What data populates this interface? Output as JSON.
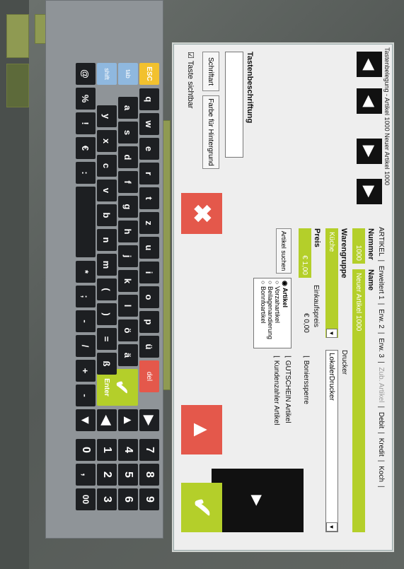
{
  "window": {
    "title": "Tastenbelegung - Artikel 1000 Neuer Artikel 1000"
  },
  "nav": {
    "first_icon": "skip-start-icon",
    "prev_icon": "arrow-left-icon",
    "next_icon": "arrow-right-icon",
    "last_icon": "skip-end-icon"
  },
  "tabs": [
    {
      "label": "ARTIKEL",
      "disabled": false
    },
    {
      "label": "Erweitert 1",
      "disabled": false
    },
    {
      "label": "Erw. 2",
      "disabled": false
    },
    {
      "label": "Erw. 3",
      "disabled": false
    },
    {
      "label": "Zub. Artikel",
      "disabled": true
    },
    {
      "label": "Debit",
      "disabled": false
    },
    {
      "label": "Kredit",
      "disabled": false
    },
    {
      "label": "Koch",
      "disabled": false
    }
  ],
  "form": {
    "nummer_label": "Nummer",
    "nummer_value": "1000",
    "name_label": "Name",
    "name_value": "Neuer Artikel 1000",
    "warengruppe_label": "Warengruppe",
    "warengruppe_value": "Küche",
    "drucker_label": "Drucker",
    "drucker_value": "LokalerDrucker",
    "preis_label": "Preis",
    "preis_value": "€ 1,00",
    "einkaufspreis_label": "Einkaufspreis",
    "einkaufspreis_value": "€ 0,00",
    "bonierssperre_label": "Bonierssperre",
    "gutschein_label": "GUTSCHEIN Artikel",
    "kundenzahler_label": "Kundenzahler Artikel",
    "artikel_suchen": "Artikel suchen",
    "types": [
      {
        "label": "Artikel",
        "selected": true
      },
      {
        "label": "Vorzahartikel",
        "selected": false
      },
      {
        "label": "Beilagenandierung",
        "selected": false
      },
      {
        "label": "Bonnfoartikel",
        "selected": false
      }
    ]
  },
  "tasten": {
    "heading": "Tastenbeschriftung",
    "schriftart": "Schriftart",
    "farbe": "Farbe für Hintergrund",
    "sichtbar": "Taste sichtbar"
  },
  "actions": {
    "cancel_icon": "close-icon",
    "up_icon": "arrow-up-icon",
    "ok_icon": "checkmark-icon",
    "black_arrow_icon": "arrow-right-icon"
  },
  "keyboard": {
    "esc": "ESC",
    "tab": "tab",
    "shift": "shift",
    "del": "del",
    "enter": "Enter",
    "row1": [
      "q",
      "w",
      "e",
      "r",
      "t",
      "z",
      "u",
      "i",
      "o",
      "p",
      "ü"
    ],
    "row2": [
      "a",
      "s",
      "d",
      "f",
      "g",
      "h",
      "j",
      "k",
      "l",
      "ö",
      "ä"
    ],
    "row3": [
      "y",
      "x",
      "c",
      "v",
      "b",
      "n",
      "m",
      "(",
      ")",
      "=",
      "ß"
    ],
    "row4": [
      "@",
      "%",
      "!",
      "€",
      ":",
      "",
      "",
      "*",
      ";",
      "-",
      "/",
      "+",
      "-"
    ],
    "nums": [
      "7",
      "8",
      "9",
      "4",
      "5",
      "6",
      "1",
      "2",
      "3",
      "0",
      ",",
      "00"
    ]
  },
  "colors": {
    "accent_green": "#b4cf2a",
    "accent_red": "#e4584b",
    "esc_yellow": "#f2c12e",
    "key_blue": "#8fb8df"
  }
}
